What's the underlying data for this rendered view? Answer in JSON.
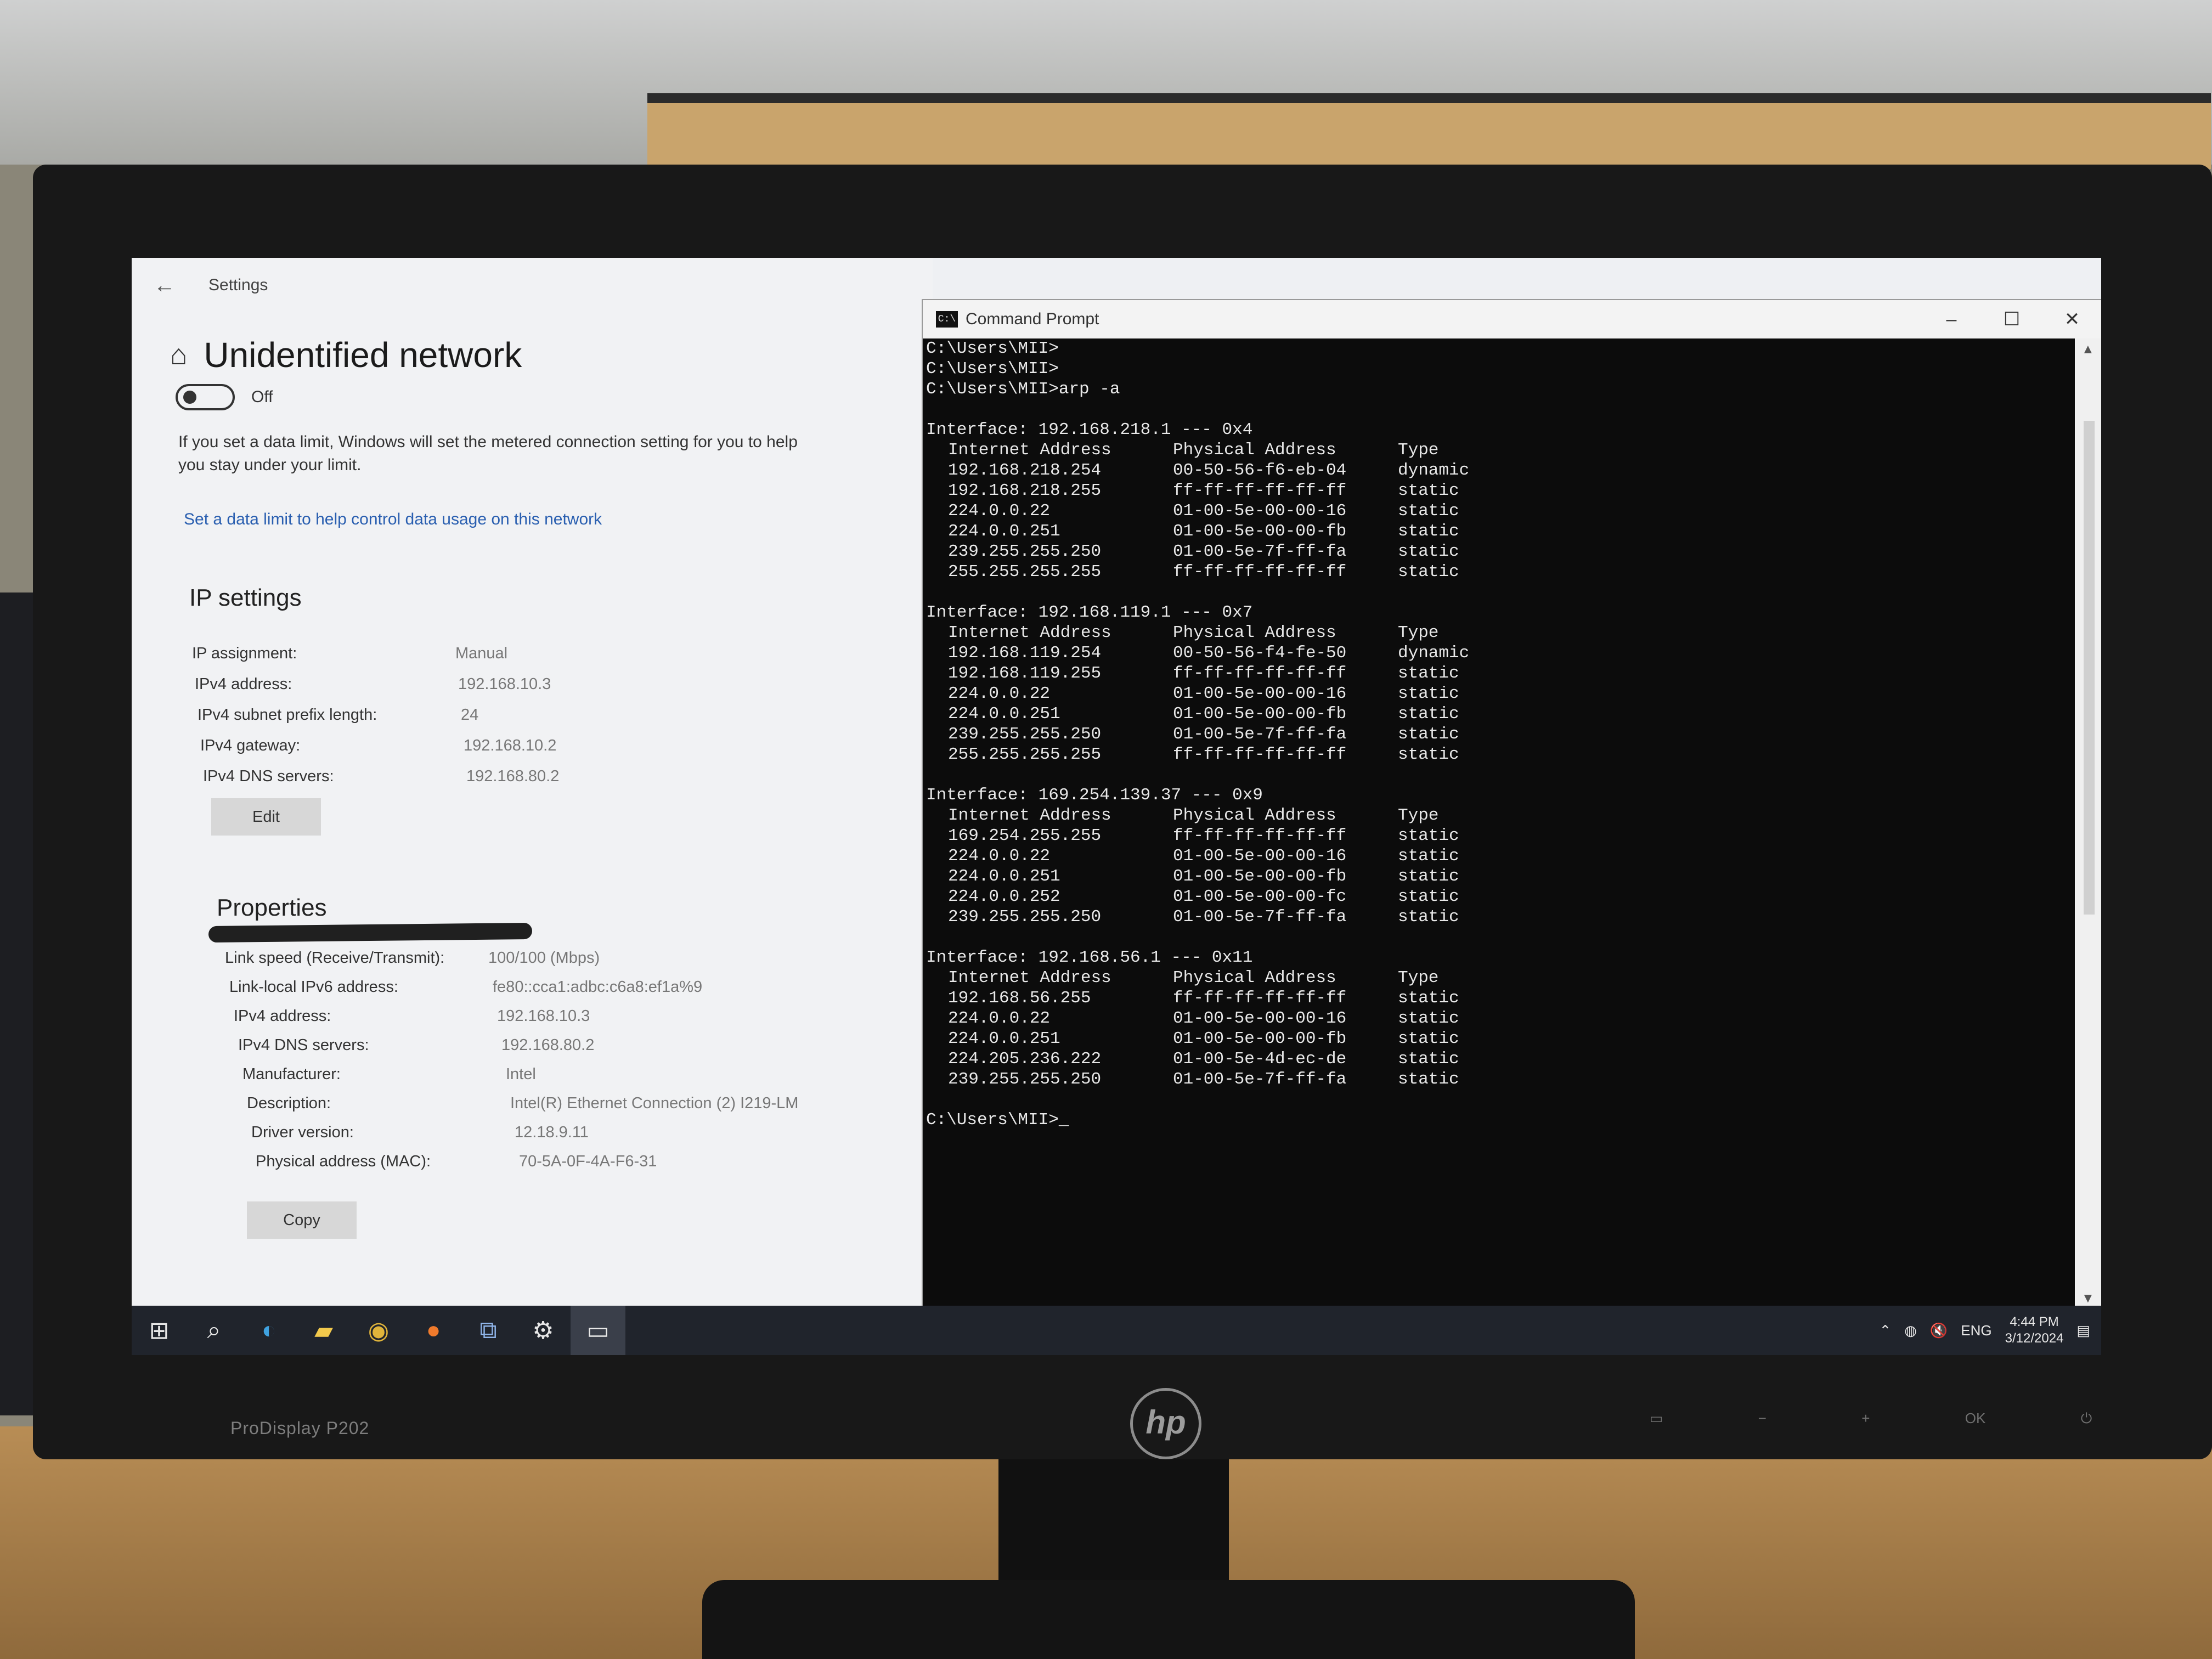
{
  "settings": {
    "window_title": "Settings",
    "page_title": "Unidentified network",
    "toggle_state": "Off",
    "data_limit_text": "If you set a data limit, Windows will set the metered connection setting for you to help you stay under your limit.",
    "data_limit_link": "Set a data limit to help control data usage on this network",
    "ip_settings": {
      "title": "IP settings",
      "rows": [
        {
          "label": "IP assignment:",
          "value": "Manual"
        },
        {
          "label": "IPv4 address:",
          "value": "192.168.10.3"
        },
        {
          "label": "IPv4 subnet prefix length:",
          "value": "24"
        },
        {
          "label": "IPv4 gateway:",
          "value": "192.168.10.2"
        },
        {
          "label": "IPv4 DNS servers:",
          "value": "192.168.80.2"
        }
      ],
      "edit_button": "Edit"
    },
    "properties": {
      "title": "Properties",
      "rows": [
        {
          "label": "Link speed (Receive/Transmit):",
          "value": "100/100 (Mbps)"
        },
        {
          "label": "Link-local IPv6 address:",
          "value": "fe80::cca1:adbc:c6a8:ef1a%9"
        },
        {
          "label": "IPv4 address:",
          "value": "192.168.10.3"
        },
        {
          "label": "IPv4 DNS servers:",
          "value": "192.168.80.2"
        },
        {
          "label": "Manufacturer:",
          "value": "Intel"
        },
        {
          "label": "Description:",
          "value": "Intel(R) Ethernet Connection (2) I219-LM"
        },
        {
          "label": "Driver version:",
          "value": "12.18.9.11"
        },
        {
          "label": "Physical address (MAC):",
          "value": "70-5A-0F-4A-F6-31"
        }
      ],
      "copy_button": "Copy"
    }
  },
  "cmd": {
    "window_title": "Command Prompt",
    "icon_text": "C:\\",
    "prompt_lines": [
      "C:\\Users\\MII>",
      "C:\\Users\\MII>",
      "C:\\Users\\MII>arp -a"
    ],
    "headers": [
      "Internet Address",
      "Physical Address",
      "Type"
    ],
    "interfaces": [
      {
        "title": "Interface: 192.168.218.1 --- 0x4",
        "rows": [
          [
            "192.168.218.254",
            "00-50-56-f6-eb-04",
            "dynamic"
          ],
          [
            "192.168.218.255",
            "ff-ff-ff-ff-ff-ff",
            "static"
          ],
          [
            "224.0.0.22",
            "01-00-5e-00-00-16",
            "static"
          ],
          [
            "224.0.0.251",
            "01-00-5e-00-00-fb",
            "static"
          ],
          [
            "239.255.255.250",
            "01-00-5e-7f-ff-fa",
            "static"
          ],
          [
            "255.255.255.255",
            "ff-ff-ff-ff-ff-ff",
            "static"
          ]
        ]
      },
      {
        "title": "Interface: 192.168.119.1 --- 0x7",
        "rows": [
          [
            "192.168.119.254",
            "00-50-56-f4-fe-50",
            "dynamic"
          ],
          [
            "192.168.119.255",
            "ff-ff-ff-ff-ff-ff",
            "static"
          ],
          [
            "224.0.0.22",
            "01-00-5e-00-00-16",
            "static"
          ],
          [
            "224.0.0.251",
            "01-00-5e-00-00-fb",
            "static"
          ],
          [
            "239.255.255.250",
            "01-00-5e-7f-ff-fa",
            "static"
          ],
          [
            "255.255.255.255",
            "ff-ff-ff-ff-ff-ff",
            "static"
          ]
        ]
      },
      {
        "title": "Interface: 169.254.139.37 --- 0x9",
        "rows": [
          [
            "169.254.255.255",
            "ff-ff-ff-ff-ff-ff",
            "static"
          ],
          [
            "224.0.0.22",
            "01-00-5e-00-00-16",
            "static"
          ],
          [
            "224.0.0.251",
            "01-00-5e-00-00-fb",
            "static"
          ],
          [
            "224.0.0.252",
            "01-00-5e-00-00-fc",
            "static"
          ],
          [
            "239.255.255.250",
            "01-00-5e-7f-ff-fa",
            "static"
          ]
        ]
      },
      {
        "title": "Interface: 192.168.56.1 --- 0x11",
        "rows": [
          [
            "192.168.56.255",
            "ff-ff-ff-ff-ff-ff",
            "static"
          ],
          [
            "224.0.0.22",
            "01-00-5e-00-00-16",
            "static"
          ],
          [
            "224.0.0.251",
            "01-00-5e-00-00-fb",
            "static"
          ],
          [
            "224.205.236.222",
            "01-00-5e-4d-ec-de",
            "static"
          ],
          [
            "239.255.255.250",
            "01-00-5e-7f-ff-fa",
            "static"
          ]
        ]
      }
    ],
    "final_prompt": "C:\\Users\\MII>_"
  },
  "taskbar": {
    "icons": [
      "start-icon",
      "search-icon",
      "edge-icon",
      "file-explorer-icon",
      "chrome-icon",
      "firefox-icon",
      "network-app-icon",
      "settings-icon",
      "cmd-icon"
    ],
    "tray": {
      "language": "ENG",
      "time": "4:44 PM",
      "date": "3/12/2024"
    }
  },
  "monitor": {
    "model_label": "ProDisplay P202",
    "brand": "hp"
  }
}
